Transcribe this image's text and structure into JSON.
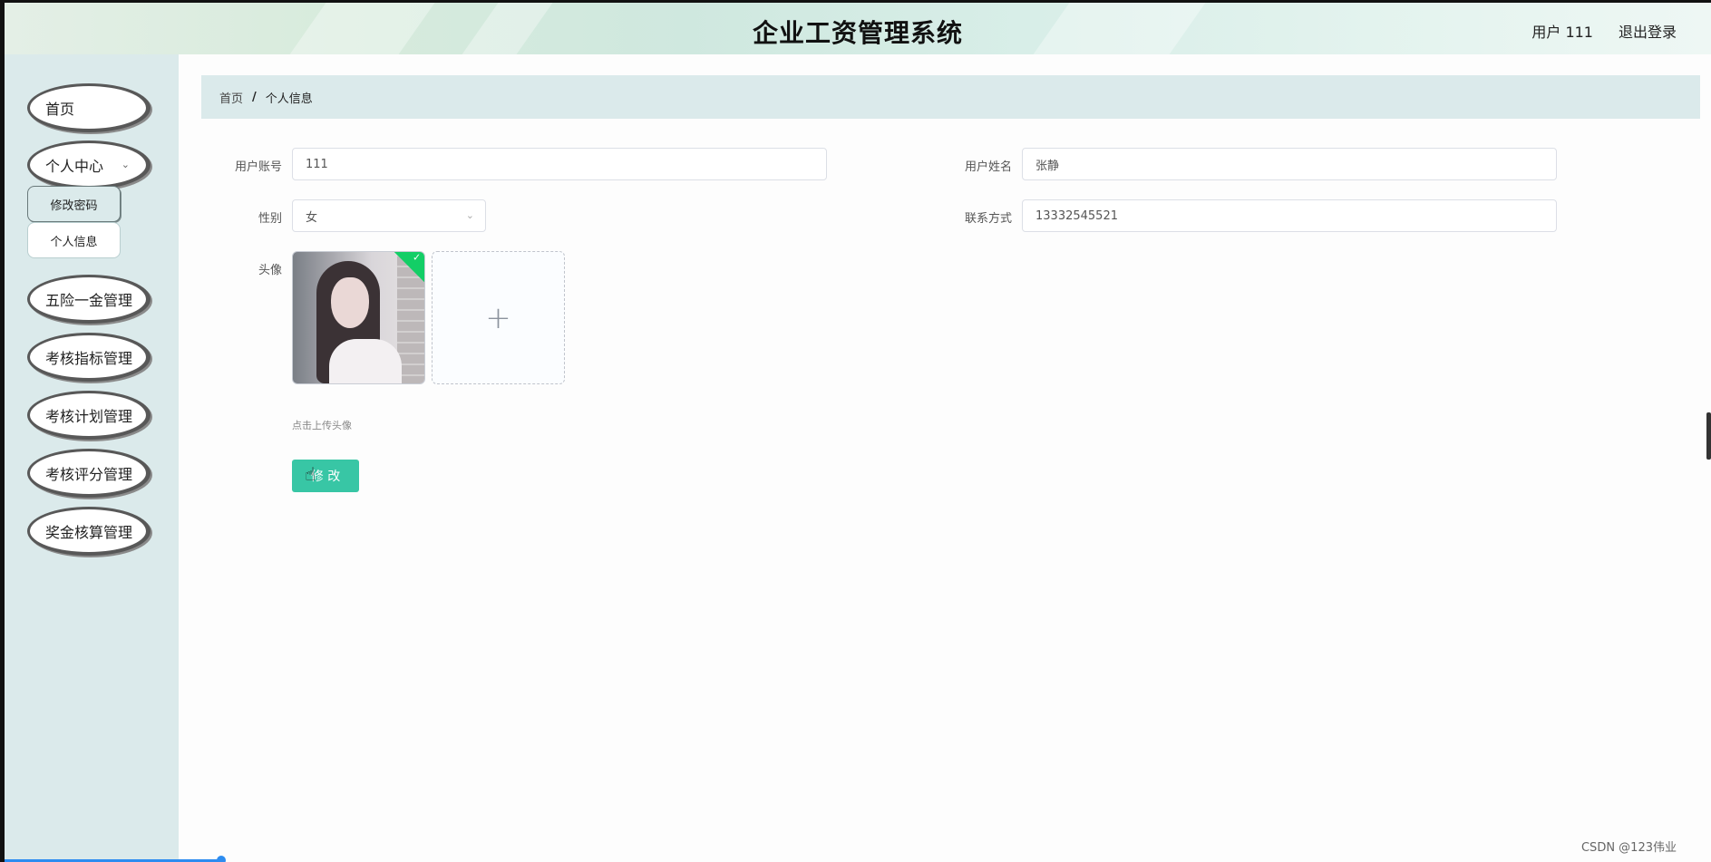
{
  "header": {
    "title": "企业工资管理系统",
    "user_label": "用户 111",
    "logout_label": "退出登录"
  },
  "sidebar": {
    "items": [
      {
        "label": "首页"
      },
      {
        "label": "个人中心"
      },
      {
        "label": "五险一金管理"
      },
      {
        "label": "考核指标管理"
      },
      {
        "label": "考核计划管理"
      },
      {
        "label": "考核评分管理"
      },
      {
        "label": "奖金核算管理"
      }
    ],
    "subitems": [
      {
        "label": "修改密码"
      },
      {
        "label": "个人信息"
      }
    ]
  },
  "breadcrumb": {
    "home": "首页",
    "separator": "/",
    "current": "个人信息"
  },
  "form": {
    "account_label": "用户账号",
    "account_value": "111",
    "name_label": "用户姓名",
    "name_value": "张静",
    "gender_label": "性别",
    "gender_value": "女",
    "phone_label": "联系方式",
    "phone_value": "13332545521",
    "avatar_label": "头像",
    "upload_tip": "点击上传头像",
    "submit_label": "修 改"
  },
  "watermark": "CSDN @123伟业",
  "colors": {
    "accent": "#38c6a5",
    "sidebar_bg": "#dbeaeb",
    "success_check": "#13ce66"
  }
}
